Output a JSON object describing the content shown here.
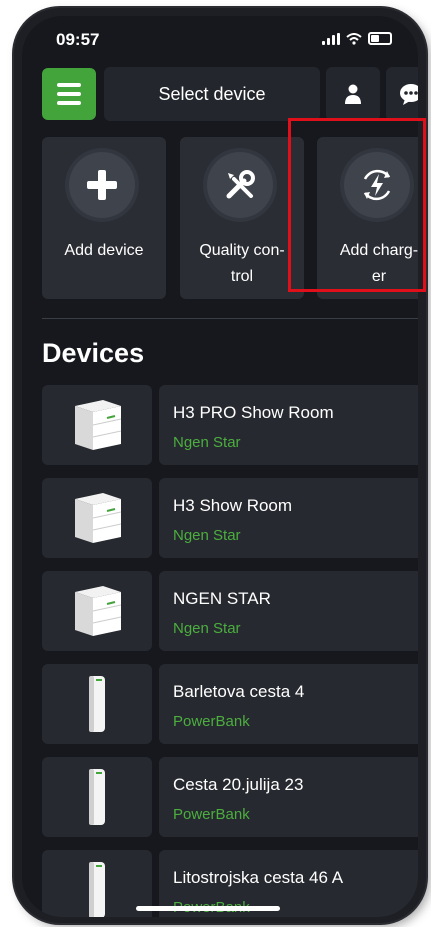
{
  "status_bar": {
    "time": "09:57"
  },
  "header": {
    "title": "Select device",
    "menu_icon": "hamburger-menu-icon",
    "profile_icon": "user-icon",
    "chat_icon": "chat-bubble-icon",
    "accent_color": "#44a43c"
  },
  "actions": [
    {
      "label": "Add device",
      "icon": "plus-icon"
    },
    {
      "label": "Quality con-\ntrol",
      "icon": "tools-icon"
    },
    {
      "label": "Add charg-\ner",
      "icon": "charger-bolt-icon",
      "highlighted": true
    }
  ],
  "devices_section": {
    "title": "Devices"
  },
  "devices": [
    {
      "name": "H3 PRO Show Room",
      "type": "Ngen Star",
      "thumb": "battery-cabinet"
    },
    {
      "name": "H3 Show Room",
      "type": "Ngen Star",
      "thumb": "battery-cabinet"
    },
    {
      "name": "NGEN STAR",
      "type": "Ngen Star",
      "thumb": "battery-cabinet"
    },
    {
      "name": "Barletova cesta 4",
      "type": "PowerBank",
      "thumb": "powerbank-tower"
    },
    {
      "name": "Cesta 20.julija 23",
      "type": "PowerBank",
      "thumb": "powerbank-tower"
    },
    {
      "name": "Litostrojska cesta 46 A",
      "type": "PowerBank",
      "thumb": "powerbank-tower"
    }
  ]
}
